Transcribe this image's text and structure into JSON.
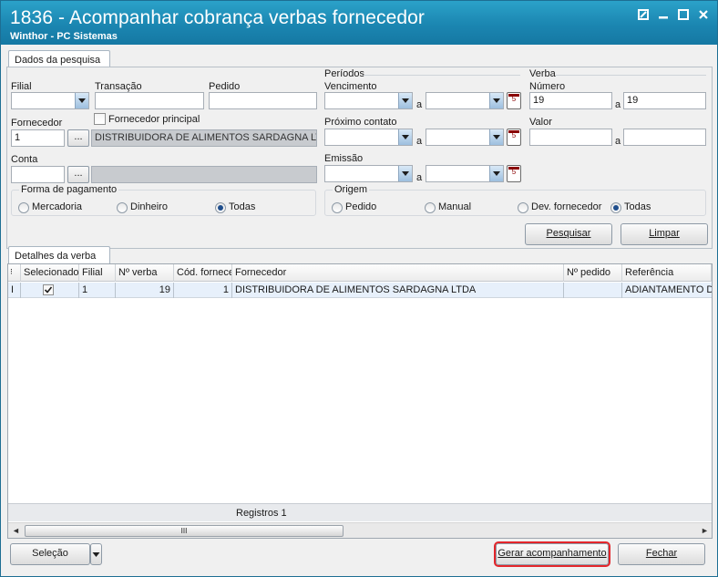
{
  "window": {
    "title": "1836 - Acompanhar cobrança verbas fornecedor",
    "subtitle": "Winthor - PC Sistemas",
    "controls": [
      "restore-icon",
      "minimize-icon",
      "maximize-icon",
      "close-icon"
    ]
  },
  "tabs": {
    "search": "Dados da pesquisa",
    "details": "Detalhes da verba"
  },
  "search": {
    "filial_label": "Filial",
    "filial_value": "",
    "transacao_label": "Transação",
    "transacao_value": "",
    "pedido_label": "Pedido",
    "pedido_value": "",
    "fornecedor_label": "Fornecedor",
    "fornecedor_code": "1",
    "fornecedor_name": "DISTRIBUIDORA DE ALIMENTOS SARDAGNA LTDA",
    "lookup_btn": "...",
    "fornecedor_principal_label": "Fornecedor principal",
    "fornecedor_principal_checked": false,
    "conta_label": "Conta",
    "conta_value": "",
    "conta_desc": "",
    "periodos_label": "Períodos",
    "vencimento_label": "Vencimento",
    "proximo_contato_label": "Próximo contato",
    "emissao_label": "Emissão",
    "range_sep": "a",
    "verba_label": "Verba",
    "numero_label": "Número",
    "numero_from": "19",
    "numero_to": "19",
    "valor_label": "Valor",
    "valor_from": "",
    "valor_to": "",
    "calendar_glyph": "5"
  },
  "forma_pagamento": {
    "title": "Forma de pagamento",
    "options": [
      "Mercadoria",
      "Dinheiro",
      "Todas"
    ],
    "selected": "Todas"
  },
  "origem": {
    "title": "Origem",
    "options": [
      "Pedido",
      "Manual",
      "Dev. fornecedor",
      "Todas"
    ],
    "selected": "Todas"
  },
  "actions": {
    "pesquisar": "Pesquisar",
    "limpar": "Limpar"
  },
  "grid": {
    "columns": [
      "Selecionado",
      "Filial",
      "Nº verba",
      "Cód. fornece",
      "Fornecedor",
      "Nº pedido",
      "Referência"
    ],
    "rows": [
      {
        "indicator": "I",
        "selecionado": true,
        "filial": "1",
        "num_verba": "19",
        "cod_fornecedor": "1",
        "fornecedor": "DISTRIBUIDORA DE ALIMENTOS SARDAGNA LTDA",
        "num_pedido": "",
        "referencia": "ADIANTAMENTO DE"
      }
    ],
    "footer": "Registros 1",
    "scroll_thumb": "III"
  },
  "bottom": {
    "selecao": "Seleção",
    "gerar": "Gerar acompanhamento",
    "fechar": "Fechar"
  },
  "colors": {
    "titlebar": "#1b86b1",
    "highlight": "#e3262b",
    "row_selected": "#e7f0fb"
  }
}
